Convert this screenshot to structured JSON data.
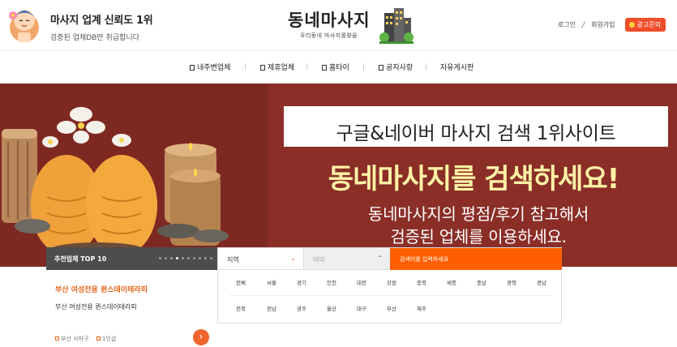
{
  "header": {
    "promo_title": "마사지 업계 신뢰도 1위",
    "promo_sub": "검증된 업체DB만 취급합니다",
    "logo_title": "동네마사지",
    "logo_tagline": "우리동네 마사지를찾을",
    "login": "로그인",
    "signup": "회원가입",
    "ad_inquiry": "광고문의"
  },
  "nav": {
    "items": [
      "내주변업체",
      "제휴업체",
      "홈타이",
      "공지사항",
      "자유게시판"
    ]
  },
  "banner": {
    "box_text": "구글&네이버 마사지 검색 1위사이트",
    "main_text": "동네마사지를 검색하세요!",
    "sub_line1": "동네마사지의 평점/후기 참고해서",
    "sub_line2": "검증된 업체를 이용하세요."
  },
  "top10": {
    "title": "추천업체 TOP 10",
    "shop_name": "부산 여성전용 퀸스데이테라피",
    "shop_desc": "부산 여성전용 퀸스데이테라피",
    "location": "부산 사하구",
    "capacity": "1인샵",
    "arrow": "›"
  },
  "search": {
    "region_label": "지역",
    "theme_label": "테마",
    "input_placeholder": "검색어를 입력하세요",
    "regions_row1": [
      "전체",
      "서울",
      "경기",
      "인천",
      "대전",
      "강원",
      "충북",
      "세종",
      "충남",
      "경북",
      "경남"
    ],
    "regions_row2": [
      "전북",
      "전남",
      "광주",
      "울산",
      "대구",
      "부산",
      "제주"
    ]
  },
  "colors": {
    "banner_bg": "#8a2e27",
    "accent_orange": "#ff5e00",
    "headline_yellow": "#fff2a6"
  }
}
